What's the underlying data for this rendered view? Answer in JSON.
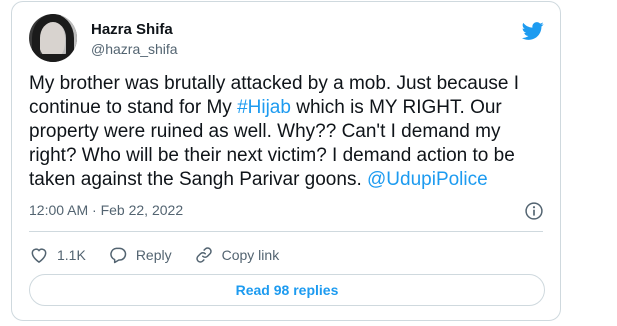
{
  "author": {
    "display_name": "Hazra Shifa",
    "handle": "@hazra_shifa"
  },
  "tweet": {
    "lines": [
      [
        {
          "t": "My brother was brutally attacked by a mob. Just because I"
        }
      ],
      [
        {
          "t": "continue to stand for My "
        },
        {
          "t": "#Hijab",
          "link": true
        },
        {
          "t": " which is MY RIGHT. Our"
        }
      ],
      [
        {
          "t": "property were ruined as well. Why?? Can't I demand my"
        }
      ],
      [
        {
          "t": "right? Who will be their next victim? I demand action to be"
        }
      ],
      [
        {
          "t": "taken against the Sangh Parivar goons. "
        },
        {
          "t": "@UdupiPolice",
          "link": true
        }
      ]
    ],
    "timestamp": "12:00 AM · Feb 22, 2022"
  },
  "actions": {
    "like_count": "1.1K",
    "reply_label": "Reply",
    "copy_link_label": "Copy link"
  },
  "read_replies_label": "Read 98 replies",
  "icons": {
    "brand": "twitter-bird-icon",
    "info": "info-icon",
    "like": "heart-icon",
    "reply": "speech-bubble-icon",
    "copy": "link-icon"
  },
  "colors": {
    "accent": "#1d9bf0",
    "text": "#0f1419",
    "secondary": "#536471",
    "border": "#cfd9de"
  }
}
